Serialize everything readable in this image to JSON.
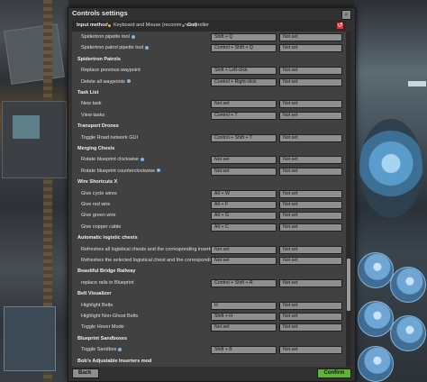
{
  "window": {
    "title": "Controls settings"
  },
  "input_method": {
    "label": "Input method",
    "options": [
      {
        "label": "Keyboard and Mouse (recommended)",
        "selected": true
      },
      {
        "label": "Controller",
        "selected": false
      }
    ]
  },
  "sections": [
    {
      "type": "row",
      "label": "Spidertron pipette tool",
      "info": true,
      "key1": "Shift + Q",
      "key2": "Not set"
    },
    {
      "type": "row",
      "label": "Spidertron patrol pipette tool",
      "info": true,
      "key1": "Control + Shift + Q",
      "key2": "Not set"
    },
    {
      "type": "section",
      "label": "Spidertron Patrols"
    },
    {
      "type": "row",
      "label": "Replace previous waypoint",
      "info": false,
      "key1": "Shift + Left-click",
      "key2": "Not set"
    },
    {
      "type": "row",
      "label": "Delete all waypoints",
      "info": true,
      "key1": "Control + Right-click",
      "key2": "Not set"
    },
    {
      "type": "section",
      "label": "Task List"
    },
    {
      "type": "row",
      "label": "New task",
      "info": false,
      "key1": "Not set",
      "key2": "Not set"
    },
    {
      "type": "row",
      "label": "View tasks",
      "info": false,
      "key1": "Control + T",
      "key2": "Not set"
    },
    {
      "type": "section",
      "label": "Transport Drones"
    },
    {
      "type": "row",
      "label": "Toggle Road network GUI",
      "info": false,
      "key1": "Control + Shift + T",
      "key2": "Not set"
    },
    {
      "type": "section",
      "label": "Merging Chests"
    },
    {
      "type": "row",
      "label": "Rotate blueprint clockwise",
      "info": true,
      "key1": "Not set",
      "key2": "Not set"
    },
    {
      "type": "row",
      "label": "Rotate blueprint counterclockwise",
      "info": true,
      "key1": "Not set",
      "key2": "Not set"
    },
    {
      "type": "section",
      "label": "Wire Shortcuts X"
    },
    {
      "type": "row",
      "label": "Give cycle wires",
      "info": false,
      "key1": "Alt + W",
      "key2": "Not set"
    },
    {
      "type": "row",
      "label": "Give red wire",
      "info": false,
      "key1": "Alt + F",
      "key2": "Not set"
    },
    {
      "type": "row",
      "label": "Give green wire",
      "info": false,
      "key1": "Alt + G",
      "key2": "Not set"
    },
    {
      "type": "row",
      "label": "Give copper cable",
      "info": false,
      "key1": "Alt + C",
      "key2": "Not set"
    },
    {
      "type": "section",
      "label": "Automatic logistic chests"
    },
    {
      "type": "row",
      "label": "Refreshes all logistical chests and the corresponding inserters",
      "info": true,
      "key1": "Not set",
      "key2": "Not set"
    },
    {
      "type": "row",
      "label": "Refreshes the selected logistical chest and the corresponding inserters",
      "info": true,
      "key1": "Not set",
      "key2": "Not set"
    },
    {
      "type": "section",
      "label": "Beautiful Bridge Railway"
    },
    {
      "type": "row",
      "label": "replace rails in Blueprint",
      "info": false,
      "key1": "Control + Shift + R",
      "key2": "Not set"
    },
    {
      "type": "section",
      "label": "Belt Visualizer"
    },
    {
      "type": "row",
      "label": "Highlight Belts",
      "info": false,
      "key1": "H",
      "key2": "Not set"
    },
    {
      "type": "row",
      "label": "Highlight Non-Ghost Belts",
      "info": false,
      "key1": "Shift + H",
      "key2": "Not set"
    },
    {
      "type": "row",
      "label": "Toggle Hover Mode",
      "info": false,
      "key1": "Not set",
      "key2": "Not set"
    },
    {
      "type": "section",
      "label": "Blueprint Sandboxes"
    },
    {
      "type": "row",
      "label": "Toggle Sandbox",
      "info": true,
      "key1": "Shift + B",
      "key2": "Not set"
    },
    {
      "type": "section",
      "label": "Bob's Adjustable Inserters mod"
    }
  ],
  "footer": {
    "back_label": "Back",
    "confirm_label": "Confirm"
  },
  "colors": {
    "confirm": "#5eb535",
    "radio_selected": "#f5b53f",
    "close_button": "#d23838"
  }
}
